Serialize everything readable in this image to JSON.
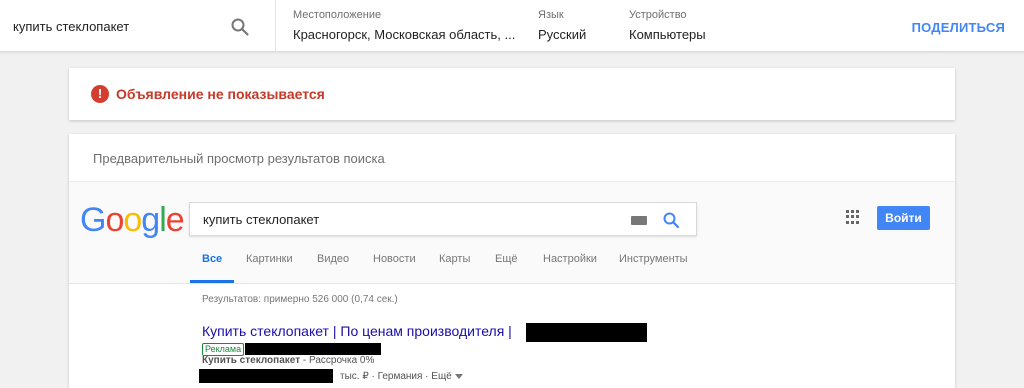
{
  "toolbar": {
    "query": "купить стеклопакет",
    "location_label": "Местоположение",
    "location_value": "Красногорск, Московская область, ...",
    "language_label": "Язык",
    "language_value": "Русский",
    "device_label": "Устройство",
    "device_value": "Компьютеры",
    "share_label": "ПОДЕЛИТЬСЯ"
  },
  "alert": {
    "icon": "!",
    "text": "Объявление не показывается"
  },
  "preview": {
    "title": "Предварительный просмотр результатов поиска",
    "logo_letters": [
      "G",
      "o",
      "o",
      "g",
      "l",
      "e"
    ],
    "logo_colors": [
      "#4285f4",
      "#ea4335",
      "#fbbc05",
      "#4285f4",
      "#34a853",
      "#ea4335"
    ],
    "search_query": "купить стеклопакет",
    "signin_label": "Войти",
    "tabs": [
      "Все",
      "Картинки",
      "Видео",
      "Новости",
      "Карты",
      "Ещё",
      "Настройки",
      "Инструменты"
    ],
    "stats": "Результатов: примерно 526 000 (0,74 сек.)",
    "ad": {
      "title": "Купить стеклопакет | По ценам производителя |",
      "badge": "Реклама",
      "desc_bold": "Купить стеклопакет",
      "desc_rest": " - Рассрочка 0%",
      "meta_rest": "тыс. ₽ · Германия · Ещё"
    }
  }
}
